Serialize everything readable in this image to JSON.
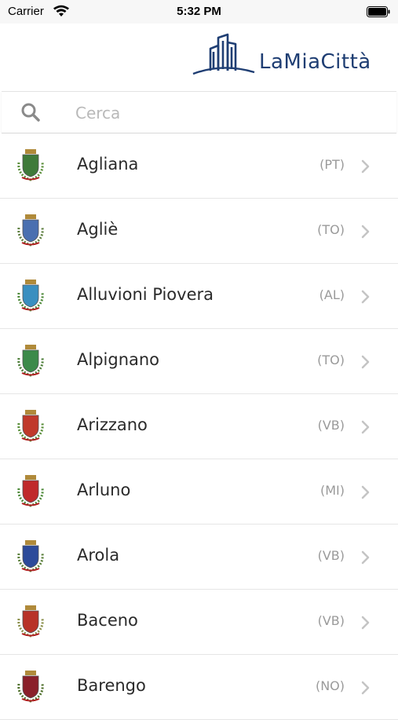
{
  "status_bar": {
    "carrier": "Carrier",
    "time": "5:32 PM"
  },
  "header": {
    "logo_text": "LaMiaCittà"
  },
  "search": {
    "placeholder": "Cerca",
    "value": ""
  },
  "cities": [
    {
      "name": "Agliana",
      "province": "(PT)",
      "shield_color": "#3f7a3a",
      "wreath_color": "#5a8f3a"
    },
    {
      "name": "Agliè",
      "province": "(TO)",
      "shield_color": "#4a6fb0",
      "wreath_color": "#5e7f40"
    },
    {
      "name": "Alluvioni Piovera",
      "province": "(AL)",
      "shield_color": "#3a8fc0",
      "wreath_color": "#4e8a3a"
    },
    {
      "name": "Alpignano",
      "province": "(TO)",
      "shield_color": "#3c8a4a",
      "wreath_color": "#4e7f3a"
    },
    {
      "name": "Arizzano",
      "province": "(VB)",
      "shield_color": "#c0392b",
      "wreath_color": "#5a8f3a"
    },
    {
      "name": "Arluno",
      "province": "(MI)",
      "shield_color": "#c0292b",
      "wreath_color": "#4e8a3a"
    },
    {
      "name": "Arola",
      "province": "(VB)",
      "shield_color": "#2c4a9a",
      "wreath_color": "#5a7f3a"
    },
    {
      "name": "Baceno",
      "province": "(VB)",
      "shield_color": "#b83228",
      "wreath_color": "#8a8f4a"
    },
    {
      "name": "Barengo",
      "province": "(NO)",
      "shield_color": "#8a1f2a",
      "wreath_color": "#4e6f2a"
    }
  ]
}
